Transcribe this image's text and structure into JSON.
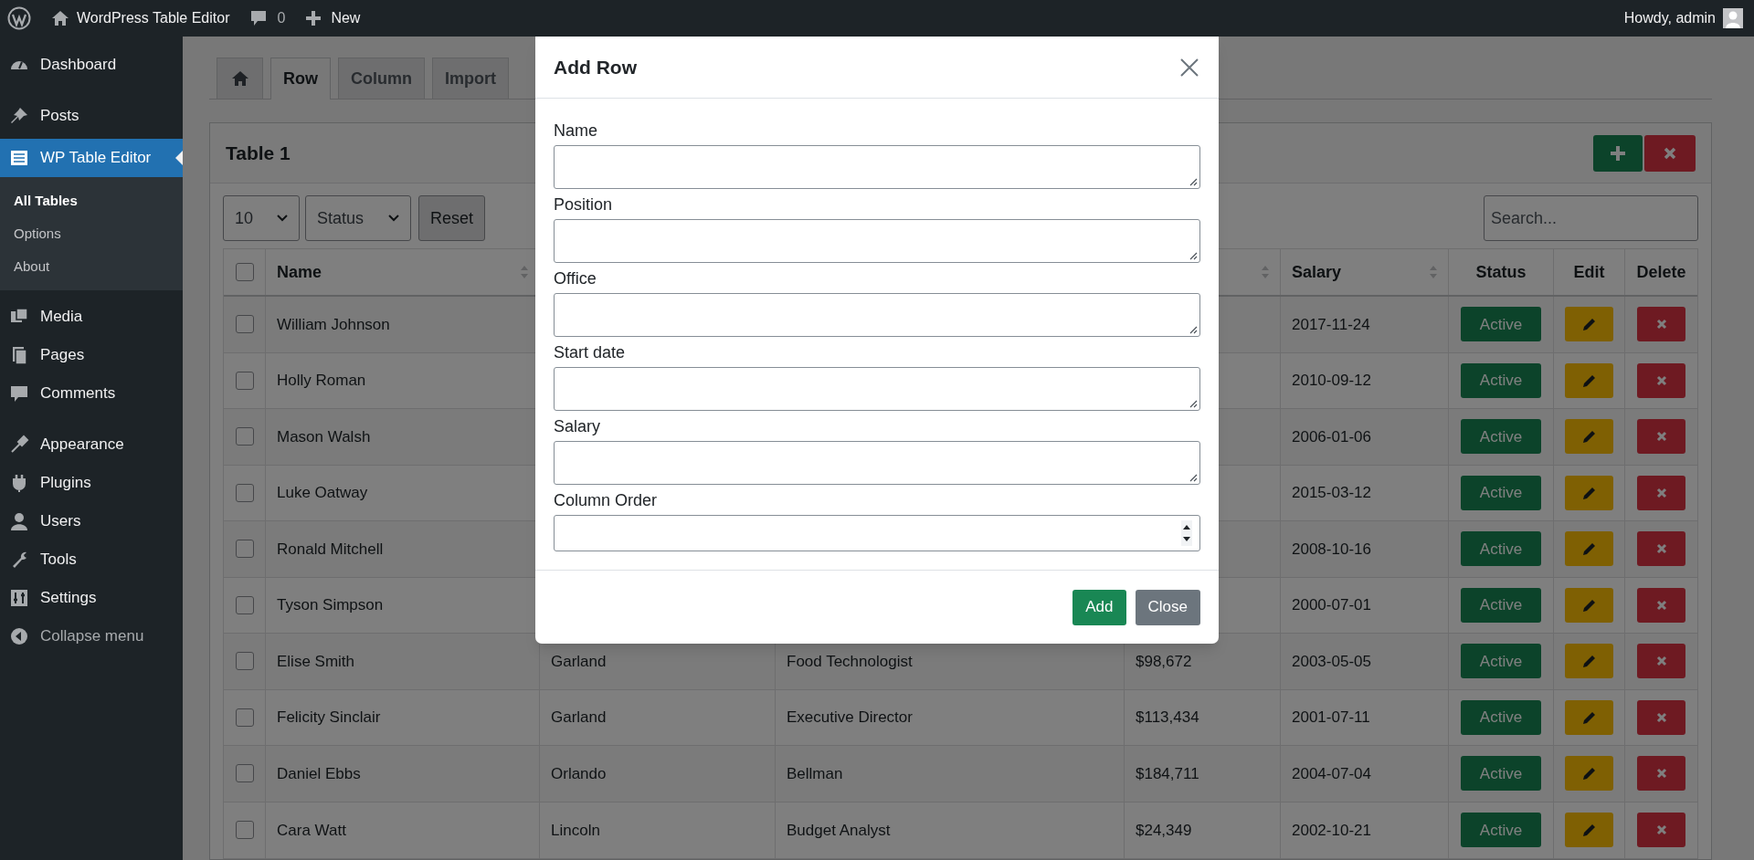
{
  "admin_bar": {
    "site": "WordPress Table Editor",
    "comments": "0",
    "new": "New",
    "greeting": "Howdy, admin"
  },
  "sidebar": {
    "items": [
      {
        "label": "Dashboard",
        "selected": false
      },
      {
        "label": "Posts",
        "selected": false
      },
      {
        "label": "WP Table Editor",
        "selected": true,
        "children": [
          {
            "label": "All Tables",
            "selected": true
          },
          {
            "label": "Options",
            "selected": false
          },
          {
            "label": "About",
            "selected": false
          }
        ]
      },
      {
        "label": "Media",
        "selected": false
      },
      {
        "label": "Pages",
        "selected": false
      },
      {
        "label": "Comments",
        "selected": false
      },
      {
        "label": "Appearance",
        "selected": false
      },
      {
        "label": "Plugins",
        "selected": false
      },
      {
        "label": "Users",
        "selected": false
      },
      {
        "label": "Tools",
        "selected": false
      },
      {
        "label": "Settings",
        "selected": false
      },
      {
        "label": "Collapse menu",
        "selected": false
      }
    ]
  },
  "tabs": [
    {
      "kind": "home",
      "selected": false
    },
    {
      "label": "Row",
      "selected": true
    },
    {
      "label": "Column",
      "selected": false
    },
    {
      "label": "Import",
      "selected": false
    }
  ],
  "panel": {
    "title": "Table 1",
    "page_size": "10",
    "status_filter": "Status",
    "reset": "Reset",
    "search": {
      "placeholder": "Search..."
    }
  },
  "table": {
    "header_checked": false,
    "columns": [
      {
        "label": "Name",
        "sortable": true
      },
      {},
      {},
      {
        "sortable": true
      },
      {
        "label": "Salary",
        "sortable": true
      },
      {
        "label": "Status",
        "sortable": false
      },
      {
        "label": "Edit",
        "sortable": false
      },
      {
        "label": "Delete",
        "sortable": false
      }
    ],
    "rows": [
      {
        "checked": false,
        "cells": [
          "William Johnson",
          null,
          null,
          null,
          "2017-11-24"
        ],
        "status": "Active"
      },
      {
        "checked": false,
        "cells": [
          "Holly Roman",
          null,
          null,
          null,
          "2010-09-12"
        ],
        "status": "Active"
      },
      {
        "checked": false,
        "cells": [
          "Mason Walsh",
          null,
          null,
          null,
          "2006-01-06"
        ],
        "status": "Active"
      },
      {
        "checked": false,
        "cells": [
          "Luke Oatway",
          null,
          null,
          null,
          "2015-03-12"
        ],
        "status": "Active"
      },
      {
        "checked": false,
        "cells": [
          "Ronald Mitchell",
          null,
          null,
          null,
          "2008-10-16"
        ],
        "status": "Active"
      },
      {
        "checked": false,
        "cells": [
          "Tyson Simpson",
          null,
          null,
          null,
          "2000-07-01"
        ],
        "status": "Active"
      },
      {
        "checked": false,
        "cells": [
          "Elise Smith",
          "Garland",
          "Food Technologist",
          "$98,672",
          "2003-05-05"
        ],
        "status": "Active"
      },
      {
        "checked": false,
        "cells": [
          "Felicity Sinclair",
          "Garland",
          "Executive Director",
          "$113,434",
          "2001-07-11"
        ],
        "status": "Active"
      },
      {
        "checked": false,
        "cells": [
          "Daniel Ebbs",
          "Orlando",
          "Bellman",
          "$184,711",
          "2004-07-04"
        ],
        "status": "Active"
      },
      {
        "checked": false,
        "cells": [
          "Cara Watt",
          "Lincoln",
          "Budget Analyst",
          "$24,349",
          "2002-10-21"
        ],
        "status": "Active"
      }
    ]
  },
  "modal": {
    "title": "Add Row",
    "fields": [
      {
        "label": "Name",
        "kind": "textarea"
      },
      {
        "label": "Position",
        "kind": "textarea"
      },
      {
        "label": "Office",
        "kind": "textarea"
      },
      {
        "label": "Start date",
        "kind": "textarea"
      },
      {
        "label": "Salary",
        "kind": "textarea"
      },
      {
        "label": "Column Order",
        "kind": "number"
      }
    ],
    "buttons": [
      {
        "label": "Add",
        "kind": "primary"
      },
      {
        "label": "Close",
        "kind": "secondary"
      }
    ]
  }
}
